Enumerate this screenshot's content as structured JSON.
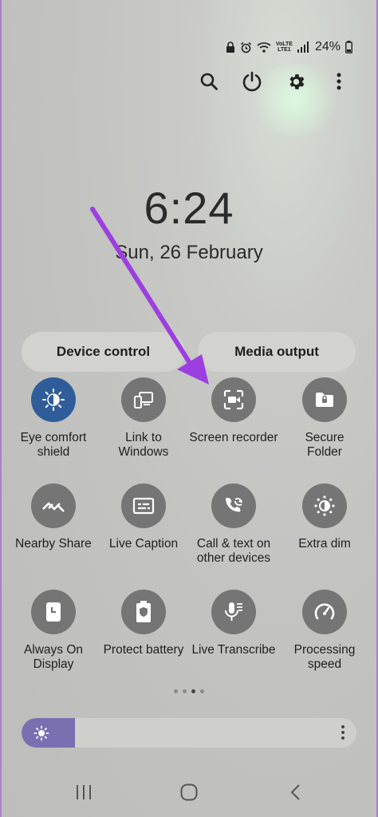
{
  "status_bar": {
    "battery_percent": "24%",
    "network_label_top": "VoLTE",
    "network_label_bottom": "LTE1",
    "icons": [
      "lock-icon",
      "alarm-icon",
      "wifi-icon",
      "volte-icon",
      "signal-icon",
      "battery-icon"
    ]
  },
  "top_actions": [
    {
      "name": "search-button",
      "icon": "search-icon"
    },
    {
      "name": "power-button",
      "icon": "power-icon"
    },
    {
      "name": "settings-button",
      "icon": "gear-icon"
    },
    {
      "name": "more-options-button",
      "icon": "more-vertical-icon"
    }
  ],
  "lockscreen": {
    "time": "6:24",
    "date": "Sun, 26 February"
  },
  "pills": {
    "device_control": "Device control",
    "media_output": "Media output"
  },
  "tiles": [
    {
      "label": "Eye comfort\nshield",
      "icon": "eye-comfort-icon",
      "active": true
    },
    {
      "label": "Link to\nWindows",
      "icon": "link-to-windows-icon",
      "active": false
    },
    {
      "label": "Screen recorder",
      "icon": "screen-recorder-icon",
      "active": false
    },
    {
      "label": "Secure\nFolder",
      "icon": "secure-folder-icon",
      "active": false
    },
    {
      "label": "Nearby Share",
      "icon": "nearby-share-icon",
      "active": false
    },
    {
      "label": "Live Caption",
      "icon": "live-caption-icon",
      "active": false
    },
    {
      "label": "Call & text on\nother devices",
      "icon": "call-text-icon",
      "active": false
    },
    {
      "label": "Extra dim",
      "icon": "extra-dim-icon",
      "active": false
    },
    {
      "label": "Always On\nDisplay",
      "icon": "always-on-display-icon",
      "active": false
    },
    {
      "label": "Protect battery",
      "icon": "protect-battery-icon",
      "active": false
    },
    {
      "label": "Live Transcribe",
      "icon": "live-transcribe-icon",
      "active": false
    },
    {
      "label": "Processing\nspeed",
      "icon": "processing-speed-icon",
      "active": false
    }
  ],
  "page_indicator": {
    "pages": 4,
    "current": 3
  },
  "brightness": {
    "level": 0.16
  },
  "nav_bar": [
    "recents-icon",
    "home-icon",
    "back-icon"
  ],
  "colors": {
    "active_tile": "#2f5d99",
    "tile": "#757575",
    "brightness_fill": "#7a6fb0",
    "annotation_arrow": "#9b3fe0"
  }
}
